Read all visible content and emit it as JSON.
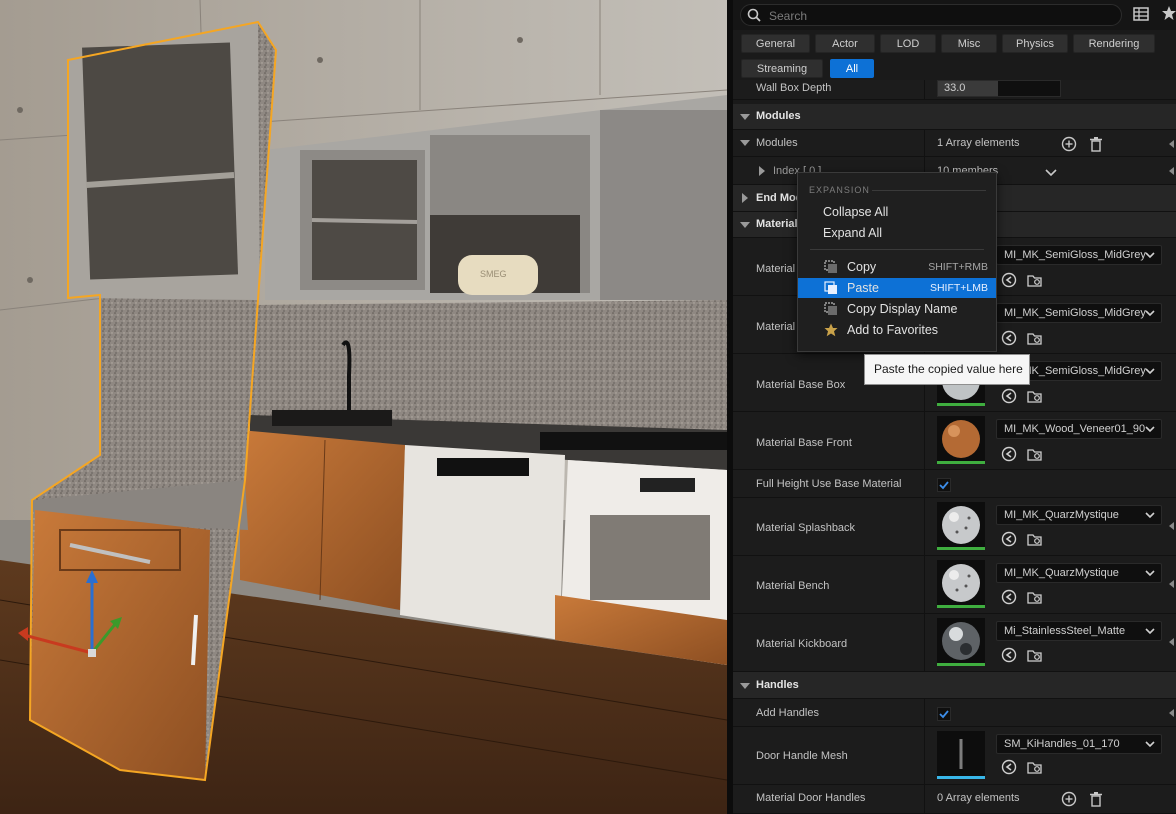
{
  "search": {
    "placeholder": "Search"
  },
  "filters": [
    "General",
    "Actor",
    "LOD",
    "Misc",
    "Physics",
    "Rendering",
    "Streaming",
    "All"
  ],
  "active_filter": "All",
  "colors": {
    "accent": "#0d71d6",
    "thumb_ok": "#3fae3f",
    "thumb_mesh": "#38b6e8",
    "selection_outline": "#f5a623"
  },
  "rows": {
    "wall_box_depth": {
      "label": "Wall Box Depth",
      "value": "33.0"
    },
    "modules_cat": {
      "label": "Modules"
    },
    "modules": {
      "label": "Modules",
      "value": "1 Array elements"
    },
    "index0": {
      "label": "Index [ 0 ]",
      "value": "10 members"
    },
    "end_modules_cat": {
      "label": "End Modules"
    },
    "material_cat": {
      "label": "Material"
    },
    "material_1": {
      "label": "Material",
      "asset": "MI_MK_SemiGloss_MidGrey"
    },
    "material_2": {
      "label": "Material",
      "asset": "MI_MK_SemiGloss_MidGrey"
    },
    "material_base_box": {
      "label": "Material Base Box",
      "asset": "MI_MK_SemiGloss_MidGrey"
    },
    "material_base_front": {
      "label": "Material Base Front",
      "asset": "MI_MK_Wood_Veneer01_90"
    },
    "full_height": {
      "label": "Full Height Use Base Material",
      "checked": true
    },
    "material_splashback": {
      "label": "Material Splashback",
      "asset": "MI_MK_QuarzMystique"
    },
    "material_bench": {
      "label": "Material Bench",
      "asset": "MI_MK_QuarzMystique"
    },
    "material_kickboard": {
      "label": "Material Kickboard",
      "asset": "Mi_StainlessSteel_Matte"
    },
    "handles_cat": {
      "label": "Handles"
    },
    "add_handles": {
      "label": "Add Handles",
      "checked": true
    },
    "door_handle_mesh": {
      "label": "Door Handle Mesh",
      "asset": "SM_KiHandles_01_170"
    },
    "material_door_handles": {
      "label": "Material Door Handles",
      "value": "0 Array elements"
    }
  },
  "context_menu": {
    "section": "EXPANSION",
    "collapse_all": "Collapse All",
    "expand_all": "Expand All",
    "copy": {
      "label": "Copy",
      "shortcut": "SHIFT+RMB"
    },
    "paste": {
      "label": "Paste",
      "shortcut": "SHIFT+LMB"
    },
    "copy_display_name": "Copy Display Name",
    "add_to_favorites": "Add to Favorites"
  },
  "tooltip": "Paste the copied value here",
  "viewport": {
    "toaster_brand": "SMEG"
  }
}
